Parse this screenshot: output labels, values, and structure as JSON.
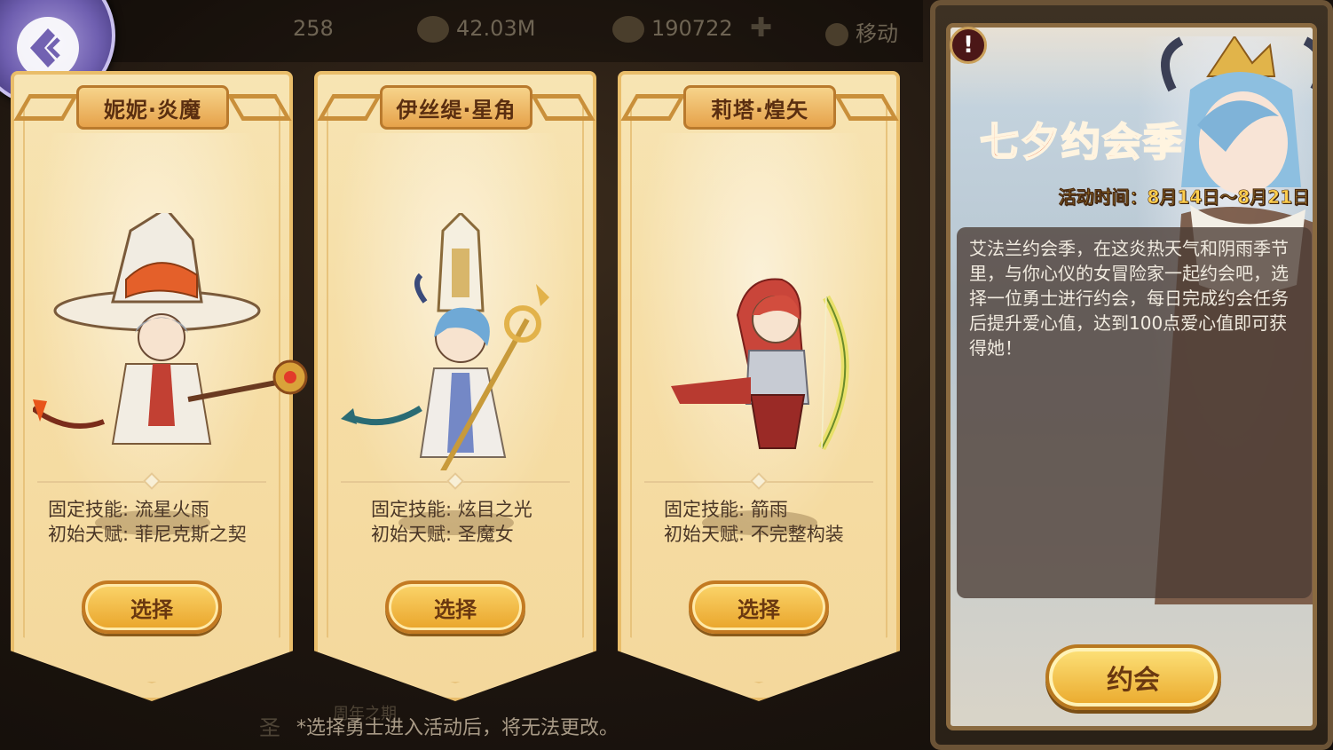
{
  "topbar": {
    "resources": [
      "258",
      "42.03M",
      "190722"
    ],
    "move_label": "移动"
  },
  "background": {
    "label_anniversary": "周年之期",
    "label_side": "圣"
  },
  "heroes": [
    {
      "name": "妮妮·炎魔",
      "skill_label": "固定技能:",
      "skill": "流星火雨",
      "talent_label": "初始天赋:",
      "talent": "菲尼克斯之契",
      "button": "选择"
    },
    {
      "name": "伊丝缇·星角",
      "skill_label": "固定技能:",
      "skill": "炫目之光",
      "talent_label": "初始天赋:",
      "talent": "圣魔女",
      "button": "选择"
    },
    {
      "name": "莉塔·煌矢",
      "skill_label": "固定技能:",
      "skill": "箭雨",
      "talent_label": "初始天赋:",
      "talent": "不完整构装",
      "button": "选择"
    }
  ],
  "notice": "*选择勇士进入活动后，将无法更改。",
  "event": {
    "title": "七夕约会季",
    "time": "活动时间：8月14日～8月21日",
    "description": "艾法兰约会季，在这炎热天气和阴雨季节里，与你心仪的女冒险家一起约会吧，选择一位勇士进行约会，每日完成约会任务后提升爱心值，达到100点爱心值即可获得她！",
    "button": "约会",
    "warning_icon": "!"
  }
}
